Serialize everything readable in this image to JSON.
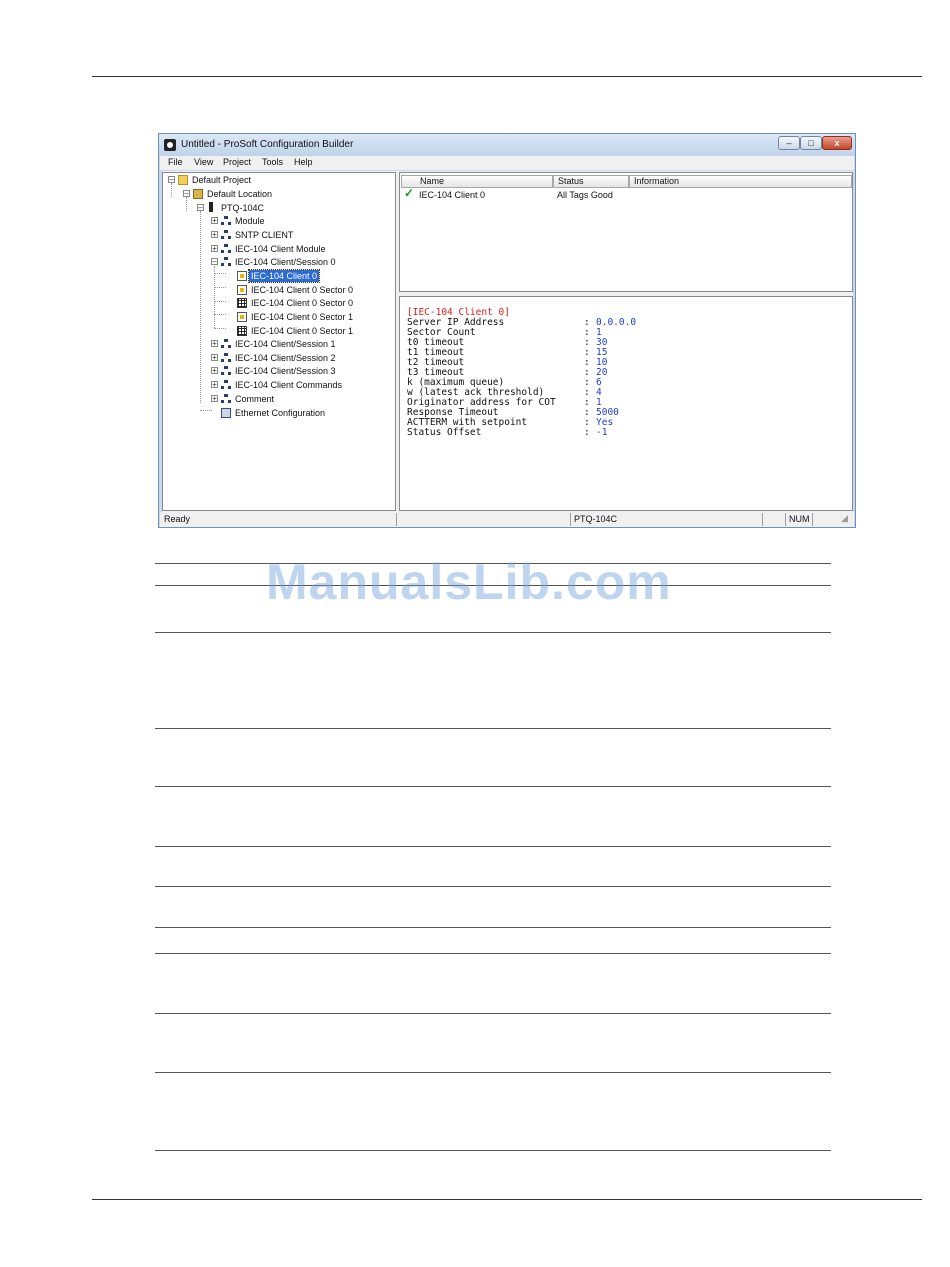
{
  "window": {
    "title": "Untitled - ProSoft Configuration Builder",
    "buttons": {
      "minimize": "–",
      "maximize": "□",
      "close": "x"
    }
  },
  "menu": [
    "File",
    "View",
    "Project",
    "Tools",
    "Help"
  ],
  "tree": [
    {
      "label": "Default Project",
      "icon": "folder-icon",
      "expander": "–"
    },
    {
      "label": "Default Location",
      "icon": "location-folder-icon",
      "expander": "–"
    },
    {
      "label": "PTQ-104C",
      "icon": "plc-module-icon",
      "expander": "–"
    },
    {
      "label": "Module",
      "icon": "network-icon",
      "expander": "+"
    },
    {
      "label": "SNTP CLIENT",
      "icon": "network-icon",
      "expander": "+"
    },
    {
      "label": "IEC-104 Client Module",
      "icon": "network-icon",
      "expander": "+"
    },
    {
      "label": "IEC-104 Client/Session 0",
      "icon": "network-icon",
      "expander": "–"
    },
    {
      "label": "IEC-104 Client 0",
      "icon": "config-doc-icon",
      "expander": ""
    },
    {
      "label": "IEC-104 Client 0 Sector 0",
      "icon": "config-doc-icon",
      "expander": ""
    },
    {
      "label": "IEC-104 Client 0 Sector 0",
      "icon": "grid-icon",
      "expander": ""
    },
    {
      "label": "IEC-104 Client 0 Sector 1",
      "icon": "config-doc-icon",
      "expander": ""
    },
    {
      "label": "IEC-104 Client 0 Sector 1",
      "icon": "grid-icon",
      "expander": ""
    },
    {
      "label": "IEC-104 Client/Session 1",
      "icon": "network-icon",
      "expander": "+"
    },
    {
      "label": "IEC-104 Client/Session 2",
      "icon": "network-icon",
      "expander": "+"
    },
    {
      "label": "IEC-104 Client/Session 3",
      "icon": "network-icon",
      "expander": "+"
    },
    {
      "label": "IEC-104 Client Commands",
      "icon": "network-icon",
      "expander": "+"
    },
    {
      "label": "Comment",
      "icon": "network-icon",
      "expander": "+"
    },
    {
      "label": "Ethernet Configuration",
      "icon": "ethernet-icon",
      "expander": ""
    }
  ],
  "list": {
    "columns": [
      "Name",
      "Status",
      "Information"
    ],
    "rows": [
      {
        "name": "IEC-104 Client 0",
        "status": "All Tags Good",
        "information": ""
      }
    ]
  },
  "details": {
    "header": "[IEC-104 Client 0]",
    "params": [
      {
        "key": "Server IP Address",
        "value": "0.0.0.0"
      },
      {
        "key": "Sector Count",
        "value": "1"
      },
      {
        "key": "t0 timeout",
        "value": "30"
      },
      {
        "key": "t1 timeout",
        "value": "15"
      },
      {
        "key": "t2 timeout",
        "value": "10"
      },
      {
        "key": "t3 timeout",
        "value": "20"
      },
      {
        "key": "k (maximum queue)",
        "value": "6"
      },
      {
        "key": "w (latest ack threshold)",
        "value": "4"
      },
      {
        "key": "Originator address for COT",
        "value": "1"
      },
      {
        "key": "Response Timeout",
        "value": "5000"
      },
      {
        "key": "ACTTERM with setpoint",
        "value": "Yes"
      },
      {
        "key": "Status Offset",
        "value": "-1"
      }
    ]
  },
  "statusbar": {
    "ready": "Ready",
    "module": "PTQ-104C",
    "num": "NUM"
  },
  "watermark": "ManualsLib.com",
  "colors": {
    "selection": "#2d6bd1",
    "detail_header": "#e02020",
    "detail_value": "#1f3fd0"
  }
}
